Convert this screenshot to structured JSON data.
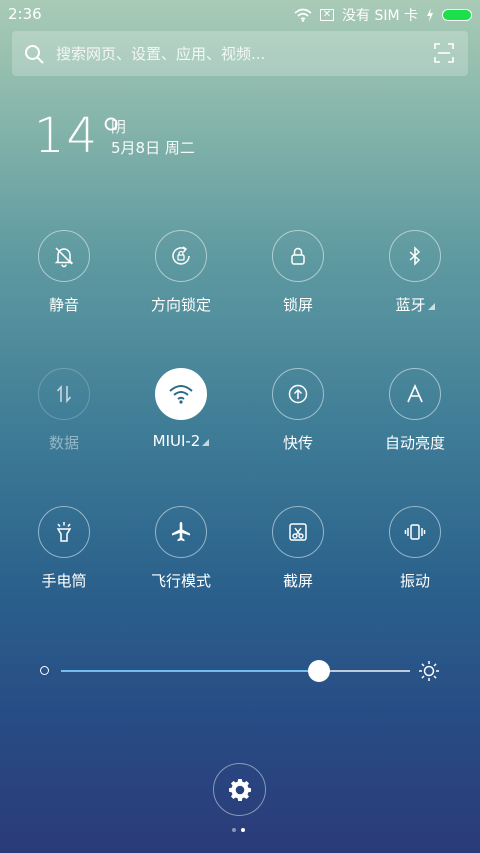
{
  "status_bar": {
    "time": "2:36",
    "sim_text": "没有 SIM 卡",
    "battery_level_percent": 100,
    "battery_color": "#19e04b"
  },
  "search": {
    "placeholder": "搜索网页、设置、应用、视频..."
  },
  "weather": {
    "temperature": "14°",
    "condition": "阴",
    "date": "5月8日 周二"
  },
  "toggles": [
    {
      "label": "静音",
      "icon": "mute-bell-icon",
      "state": "off"
    },
    {
      "label": "方向锁定",
      "icon": "rotation-lock-icon",
      "state": "off"
    },
    {
      "label": "锁屏",
      "icon": "lock-icon",
      "state": "off"
    },
    {
      "label": "蓝牙",
      "icon": "bluetooth-icon",
      "state": "off",
      "has_menu": true
    },
    {
      "label": "数据",
      "icon": "mobile-data-icon",
      "state": "disabled"
    },
    {
      "label": "MIUI-2",
      "icon": "wifi-icon",
      "state": "on",
      "has_menu": true
    },
    {
      "label": "快传",
      "icon": "quick-transfer-icon",
      "state": "off"
    },
    {
      "label": "自动亮度",
      "icon": "auto-brightness-icon",
      "state": "off"
    },
    {
      "label": "手电筒",
      "icon": "flashlight-icon",
      "state": "off"
    },
    {
      "label": "飞行模式",
      "icon": "airplane-icon",
      "state": "off"
    },
    {
      "label": "截屏",
      "icon": "screenshot-icon",
      "state": "off"
    },
    {
      "label": "振动",
      "icon": "vibrate-icon",
      "state": "off"
    }
  ],
  "brightness": {
    "level": 0.74,
    "accent": "#6fc0ee"
  },
  "pager": {
    "pages": 2,
    "current": 2
  }
}
